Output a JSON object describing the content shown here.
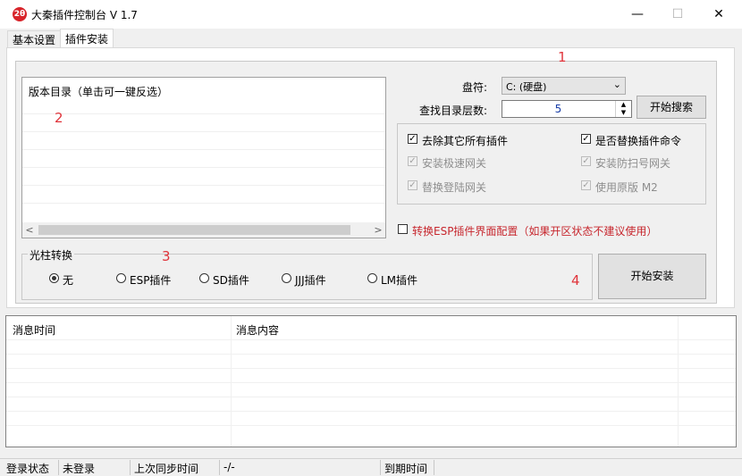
{
  "window": {
    "title": "大秦插件控制台 V 1.7",
    "icon_label": "2θ",
    "minimize_glyph": "—",
    "maximize_glyph": "☐",
    "close_glyph": "✕"
  },
  "tabs": [
    {
      "label": "基本设置",
      "active": false
    },
    {
      "label": "插件安装",
      "active": true
    }
  ],
  "annotations": {
    "n1": "1",
    "n2": "2",
    "n3": "3",
    "n4": "4"
  },
  "version_list": {
    "header": "版本目录（单击可一键反选）",
    "scroll_left": "<",
    "scroll_right": ">"
  },
  "drive": {
    "label": "盘符:",
    "value": "C: (硬盘)",
    "chevron": "⌄"
  },
  "depth": {
    "label": "查找目录层数:",
    "value": "5",
    "up": "▲",
    "down": "▼"
  },
  "search_button": "开始搜索",
  "options": [
    {
      "label": "去除其它所有插件",
      "checked": true,
      "disabled": false
    },
    {
      "label": "是否替换插件命令",
      "checked": true,
      "disabled": false
    },
    {
      "label": "安装极速网关",
      "checked": true,
      "disabled": true
    },
    {
      "label": "安装防扫号网关",
      "checked": true,
      "disabled": true
    },
    {
      "label": "替换登陆网关",
      "checked": true,
      "disabled": true
    },
    {
      "label": "使用原版 M2",
      "checked": true,
      "disabled": true
    }
  ],
  "esp_config": {
    "label": "转换ESP插件界面配置（如果开区状态不建议使用）",
    "checked": false
  },
  "light_pillar": {
    "legend": "光柱转换",
    "options": [
      {
        "label": "无",
        "selected": true
      },
      {
        "label": "ESP插件",
        "selected": false
      },
      {
        "label": "SD插件",
        "selected": false
      },
      {
        "label": "JJJ插件",
        "selected": false
      },
      {
        "label": "LM插件",
        "selected": false
      }
    ]
  },
  "install_button": "开始安装",
  "log": {
    "col_time": "消息时间",
    "col_content": "消息内容"
  },
  "status_bar": {
    "login_label": "登录状态",
    "login_value": "未登录",
    "sync_label": "上次同步时间",
    "sync_value": "-/-",
    "expire_label": "到期时间"
  },
  "colors": {
    "annotation_red": "#e0333a",
    "esp_label_red": "#c7272e",
    "spin_value_blue": "#1a3fa8"
  }
}
